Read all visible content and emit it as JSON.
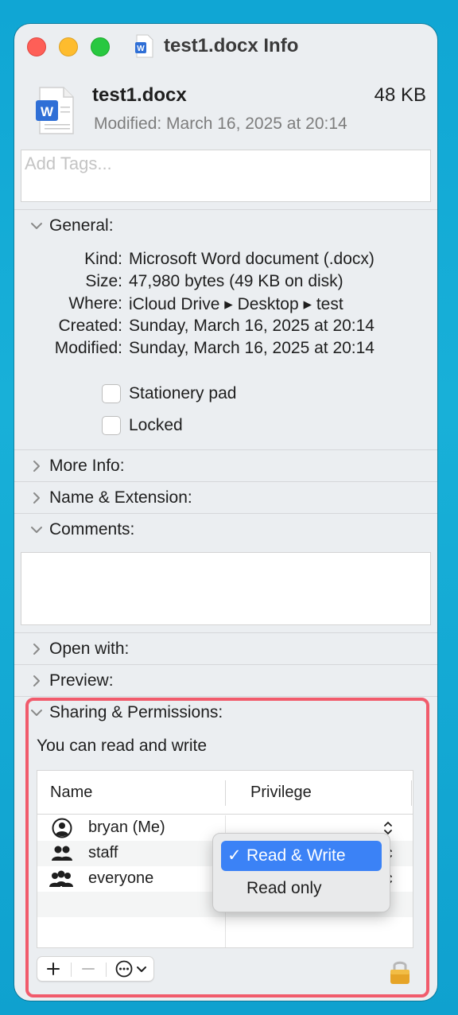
{
  "window": {
    "title": "test1.docx Info"
  },
  "file": {
    "name": "test1.docx",
    "size": "48 KB",
    "modified": "Modified: March 16, 2025 at 20:14"
  },
  "tags": {
    "placeholder": "Add Tags..."
  },
  "general": {
    "label": "General:",
    "rows": [
      {
        "key": "Kind:",
        "value": "Microsoft Word document (.docx)"
      },
      {
        "key": "Size:",
        "value": "47,980 bytes (49 KB on disk)"
      },
      {
        "key": "Where:",
        "value": "iCloud Drive ▸ Desktop ▸ test"
      },
      {
        "key": "Created:",
        "value": "Sunday, March 16, 2025 at 20:14"
      },
      {
        "key": "Modified:",
        "value": "Sunday, March 16, 2025 at 20:14"
      }
    ],
    "stationery_label": "Stationery pad",
    "stationery_checked": false,
    "locked_label": "Locked",
    "locked_checked": false
  },
  "sections": {
    "more_info": "More Info:",
    "name_extension": "Name & Extension:",
    "comments": "Comments:",
    "open_with": "Open with:",
    "preview": "Preview:",
    "sharing": "Sharing & Permissions:"
  },
  "sharing": {
    "status": "You can read and write",
    "columns": {
      "name": "Name",
      "privilege": "Privilege"
    },
    "users": [
      {
        "name": "bryan (Me)",
        "icon": "user-icon"
      },
      {
        "name": "staff",
        "icon": "group-icon"
      },
      {
        "name": "everyone",
        "icon": "everyone-icon"
      }
    ]
  },
  "privilege_menu": {
    "selected_check": "✓",
    "options": [
      "Read & Write",
      "Read only"
    ],
    "selected": "Read & Write"
  },
  "colors": {
    "accent": "#3b82f6",
    "highlight": "#f15b6c",
    "word_blue": "#2f6fd6"
  }
}
